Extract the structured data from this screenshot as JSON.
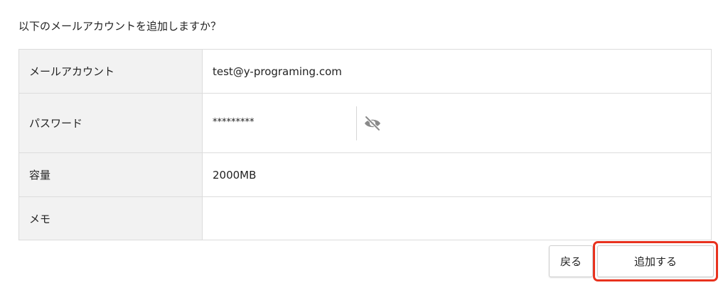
{
  "prompt": "以下のメールアカウントを追加しますか？",
  "rows": [
    {
      "label": "メールアカウント",
      "value": "test@y-programing.com"
    },
    {
      "label": "パスワード",
      "value": "*********"
    },
    {
      "label": "容量",
      "value": "2000MB"
    },
    {
      "label": "メモ",
      "value": ""
    }
  ],
  "password_toggle_icon": "eye-slash-icon",
  "buttons": {
    "back_label": "戻る",
    "add_label": "追加する"
  },
  "colors": {
    "label_bg": "#f2f2f2",
    "border": "#dcdcdc",
    "highlight": "#e8321e",
    "icon": "#8a8a8a"
  }
}
